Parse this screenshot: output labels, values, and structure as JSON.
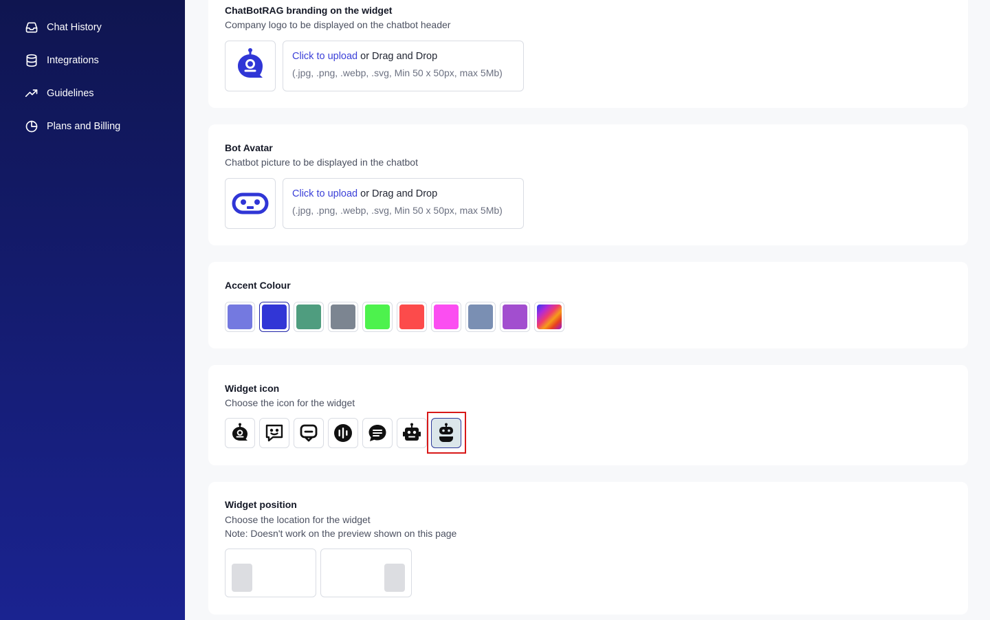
{
  "sidebar": {
    "items": [
      {
        "label": "Chat History",
        "icon": "inbox-icon"
      },
      {
        "label": "Integrations",
        "icon": "database-icon"
      },
      {
        "label": "Guidelines",
        "icon": "trending-up-icon"
      },
      {
        "label": "Plans and Billing",
        "icon": "clock-pie-icon"
      }
    ]
  },
  "branding": {
    "title": "ChatBotRAG branding on the widget",
    "description": "Company logo to be displayed on the chatbot header",
    "upload_link": "Click to upload",
    "upload_text": " or Drag and Drop",
    "upload_hint": "(.jpg, .png, .webp, .svg, Min 50 x 50px, max 5Mb)"
  },
  "avatar": {
    "title": "Bot Avatar",
    "description": "Chatbot picture to be displayed in the chatbot",
    "upload_link": "Click to upload",
    "upload_text": " or Drag and Drop",
    "upload_hint": "(.jpg, .png, .webp, .svg, Min 50 x 50px, max 5Mb)"
  },
  "accent": {
    "title": "Accent Colour",
    "colors": [
      "#7479e0",
      "#3136d6",
      "#4f9d7f",
      "#7c8591",
      "#4df24d",
      "#fc4b4b",
      "#fb4ef1",
      "#7a8fb3",
      "#a24ecf",
      "gradient"
    ],
    "selected_index": 1
  },
  "widget_icon": {
    "title": "Widget icon",
    "description": "Choose the icon for the widget",
    "options": [
      "robot-bubble-icon",
      "smile-message-icon",
      "chat-square-icon",
      "audio-wave-icon",
      "message-lines-icon",
      "robot-head-icon",
      "robot-face-icon"
    ],
    "selected_index": 6
  },
  "widget_position": {
    "title": "Widget position",
    "description": "Choose the location for the widget",
    "note": "Note: Doesn't work on the preview shown on this page",
    "options": [
      "left",
      "right"
    ]
  }
}
